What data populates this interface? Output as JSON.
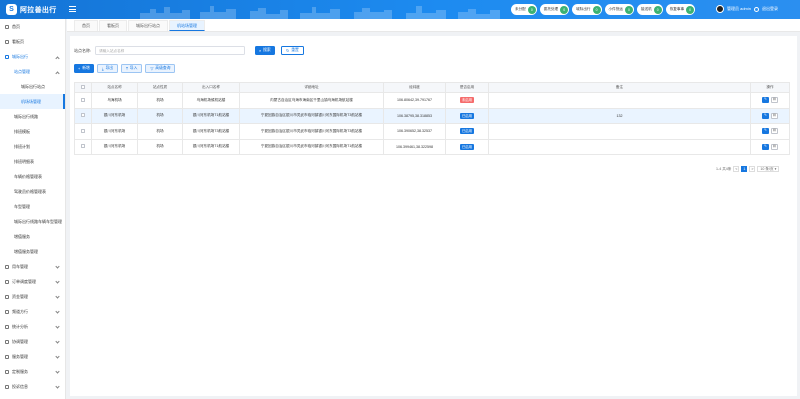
{
  "brand": {
    "logo_char": "S",
    "name": "阿拉善出行"
  },
  "header": {
    "pills": [
      {
        "label": "未分配",
        "count": "0"
      },
      {
        "label": "委托处理",
        "count": "0"
      },
      {
        "label": "城际出行",
        "count": "0"
      },
      {
        "label": "小件快运",
        "count": "0"
      },
      {
        "label": "接送机",
        "count": "0"
      },
      {
        "label": "恢复事事",
        "count": "0"
      }
    ],
    "user_label": "管理员 admin",
    "logout_label": "退出登录"
  },
  "sidebar": {
    "items": [
      {
        "label": "首页",
        "level": 0
      },
      {
        "label": "看板页",
        "level": 0
      },
      {
        "label": "城际出行",
        "level": 0,
        "open": true
      },
      {
        "label": "站点管理",
        "level": 1,
        "open": true
      },
      {
        "label": "城际出行站点",
        "level": 2
      },
      {
        "label": "机场场管理",
        "level": 2,
        "active": true
      },
      {
        "label": "城际出行线路",
        "level": 1
      },
      {
        "label": "排班模板",
        "level": 1
      },
      {
        "label": "排班计划",
        "level": 1
      },
      {
        "label": "排班明细表",
        "level": 1
      },
      {
        "label": "车辆价格管理表",
        "level": 1
      },
      {
        "label": "驾驶员价格管理表",
        "level": 1
      },
      {
        "label": "车型管理",
        "level": 1
      },
      {
        "label": "城际出行线路车辆车型管理",
        "level": 1
      },
      {
        "label": "增值服务",
        "level": 1
      },
      {
        "label": "增值服务管理",
        "level": 1
      },
      {
        "label": "用车管理",
        "level": 0
      },
      {
        "label": "订单调度管理",
        "level": 0
      },
      {
        "label": "资金管理",
        "level": 0
      },
      {
        "label": "频道方行",
        "level": 0
      },
      {
        "label": "统计分析",
        "level": 0
      },
      {
        "label": "协调管理",
        "level": 0
      },
      {
        "label": "服务管理",
        "level": 0
      },
      {
        "label": "定制服务",
        "level": 0
      },
      {
        "label": "投诉信息",
        "level": 0
      }
    ]
  },
  "tabs": [
    {
      "label": "首页",
      "active": false
    },
    {
      "label": "看板页",
      "active": false
    },
    {
      "label": "城际出行站点",
      "active": false
    },
    {
      "label": "机站场管理",
      "active": true
    }
  ],
  "search": {
    "label": "站点名称:",
    "placeholder": "请输入站点名称",
    "search_btn": "搜索",
    "reset_btn": "重置"
  },
  "toolbar": {
    "add": "新增",
    "export": "导出",
    "import": "导入",
    "advanced": "高级查询"
  },
  "table": {
    "columns": [
      "站点名称",
      "站点性质",
      "出入口名称",
      "详细地址",
      "经纬度",
      "是否启用",
      "备注",
      "操作"
    ],
    "rows": [
      {
        "name": "乌海机场",
        "type": "机场",
        "gate": "乌海机场候机站楼",
        "address": "内蒙古自治区乌海市海南区千里山镇乌海机场航站楼",
        "coords": "106.80642,39.791767",
        "status": "未启用",
        "status_on": false,
        "remark": "",
        "highlight": false
      },
      {
        "name": "银川河东机场",
        "type": "机场",
        "gate": "银川河东机场T1航站楼",
        "address": "宁夏回族自治区银川市灵武市临河镇银川河东国际机场T3航站楼",
        "coords": "106.38795,38.318853",
        "status": "已启用",
        "status_on": true,
        "remark": "132",
        "highlight": true
      },
      {
        "name": "银川河东机场",
        "type": "机场",
        "gate": "银川河东机场T3航站楼",
        "address": "宁夏回族自治区银川市灵武市临河镇银川河东国际机场T3航站楼",
        "coords": "106.390652,38.32537",
        "status": "已启用",
        "status_on": true,
        "remark": "",
        "highlight": false
      },
      {
        "name": "银川河东机场",
        "type": "机场",
        "gate": "银川河东机场T1航站楼",
        "address": "宁夏回族自治区银川市灵武市临河镇银川河东国际机场T1航站楼",
        "coords": "106.399461,38.322598",
        "status": "已启用",
        "status_on": true,
        "remark": "",
        "highlight": false
      }
    ]
  },
  "pager": {
    "range": "1-4 共4条",
    "prev": "<",
    "current": "1",
    "next": ">",
    "page_size": "10 条/页"
  },
  "colors": {
    "primary": "#1677e0",
    "danger": "#f56c6c",
    "badge_green": "#3bb273"
  }
}
